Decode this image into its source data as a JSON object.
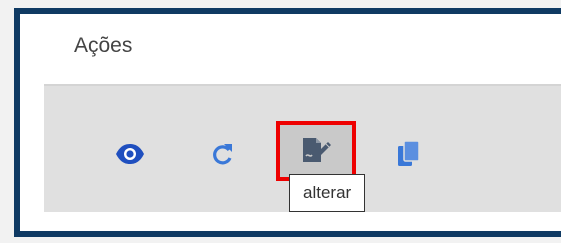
{
  "panel": {
    "title": "Ações"
  },
  "actions": {
    "view_icon": "eye-icon",
    "refresh_icon": "refresh-icon",
    "edit_icon": "edit-document-icon",
    "copy_icon": "copy-icon",
    "highlighted": "edit"
  },
  "tooltip": {
    "text": "alterar"
  },
  "colors": {
    "frame_border": "#0f3a63",
    "highlight_border": "#ee0000",
    "view_icon": "#1f4fbf",
    "refresh_icon": "#3a78d8",
    "edit_icon": "#4a5a70",
    "copy_icon": "#3a78d8",
    "toolbar_bg": "#e0e0e0"
  }
}
